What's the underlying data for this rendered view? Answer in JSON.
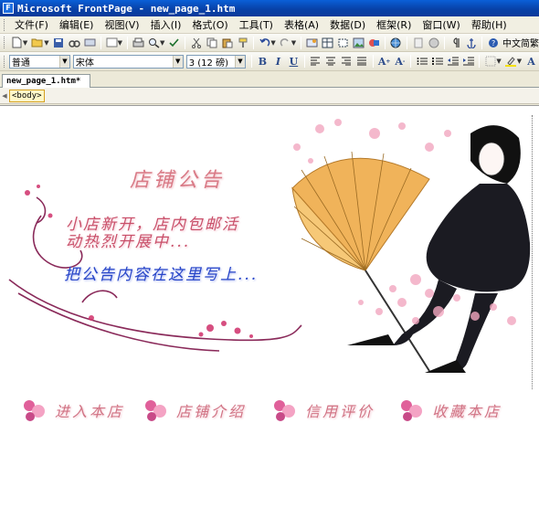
{
  "window": {
    "title": "Microsoft FrontPage - new_page_1.htm"
  },
  "menu": [
    "文件(F)",
    "编辑(E)",
    "视图(V)",
    "插入(I)",
    "格式(O)",
    "工具(T)",
    "表格(A)",
    "数据(D)",
    "框架(R)",
    "窗口(W)",
    "帮助(H)"
  ],
  "toolbar": {
    "language_button": "中文简繁"
  },
  "format": {
    "style": "普通",
    "font": "宋体",
    "size": "3 (12 磅)"
  },
  "tabs": [
    {
      "label": "new_page_1.htm*"
    }
  ],
  "tagbar": {
    "tag": "<body>"
  },
  "page": {
    "title": "店铺公告",
    "line1": "小店新开，店内包邮活",
    "line2": "动热烈开展中...",
    "line3": "把公告内容在这里写上...",
    "nav": [
      "进入本店",
      "店铺介绍",
      "信用评价",
      "收藏本店"
    ]
  },
  "colors": {
    "title_bar": "#0842a8",
    "accent_pink": "#d97a86",
    "accent_blue": "#2745c8"
  }
}
